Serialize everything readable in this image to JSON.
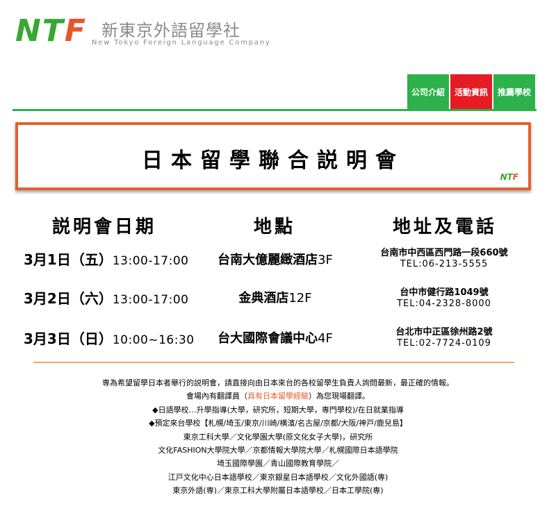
{
  "logo": {
    "n": "N",
    "t": "T",
    "f": "F",
    "chinese_name": "新東京外語留學社",
    "english_name": "New Tokyo Foreign Language Company"
  },
  "nav": {
    "items": [
      {
        "label": "公司介紹",
        "color": "#2db14a"
      },
      {
        "label": "活動資訊",
        "color": "#e51c24"
      },
      {
        "label": "推薦學校",
        "color": "#2db14a"
      }
    ]
  },
  "banner": {
    "title": "日本留學聯合説明會",
    "logo_n": "N",
    "logo_t": "T",
    "logo_f": "F",
    "border_color": "#e4612a"
  },
  "table": {
    "headers": [
      "説明會日期",
      "地點",
      "地址及電話"
    ],
    "rows": [
      {
        "date": "3月1日（五）",
        "time": "13:00-17:00",
        "place": "台南大億麗緻酒店",
        "floor": "3F",
        "address": "台南市中西區西門路一段660號",
        "tel": "TEL:06-213-5555"
      },
      {
        "date": "3月2日（六）",
        "time": "13:00-17:00",
        "place": "金典酒店",
        "floor": "12F",
        "address": "台中市健行路1049號",
        "tel": "TEL:04-2328-8000"
      },
      {
        "date": "3月3日（日）",
        "time": "10:00~16:30",
        "place": "台大國際會議中心",
        "floor": "4F",
        "address": "台北市中正區徐州路2號",
        "tel": "TEL:02-7724-0109"
      }
    ]
  },
  "notes": {
    "line1": "専為希望留學日本者舉行的説明會，請直接向由日本來台的各校留學生負責人詢問最新，最正確的情報。",
    "line2_pre": "會場內有翻譯員（",
    "line2_hl": "具有日本留學經驗",
    "line2_post": "）為您現場翻譯。",
    "line3": "◆日語學校…升學指導(大學，研究所，短期大學，専門學校)/在日就業指導",
    "line4": "◆預定來台學校【札幌/埼玉/東京/川崎/横濱/名古屋/京都/大阪/神戸/鹿兒島】",
    "line5": "東京工科大學／文化學園大學(原文化女子大學)，研究所",
    "line6": "文化FASHION大學院大學／京都情報大學院大學／札幌國際日本語學院",
    "line7": "埼玉國際學園／青山國際教育學院／",
    "line8": "江戸文化中心日本語學校／東京銀星日本語學校／文化外國語(専)",
    "line9": "東京外語(専)／東京工科大學附屬日本語學校／日本工學院(専)",
    "highlight_color": "#e4612a"
  }
}
